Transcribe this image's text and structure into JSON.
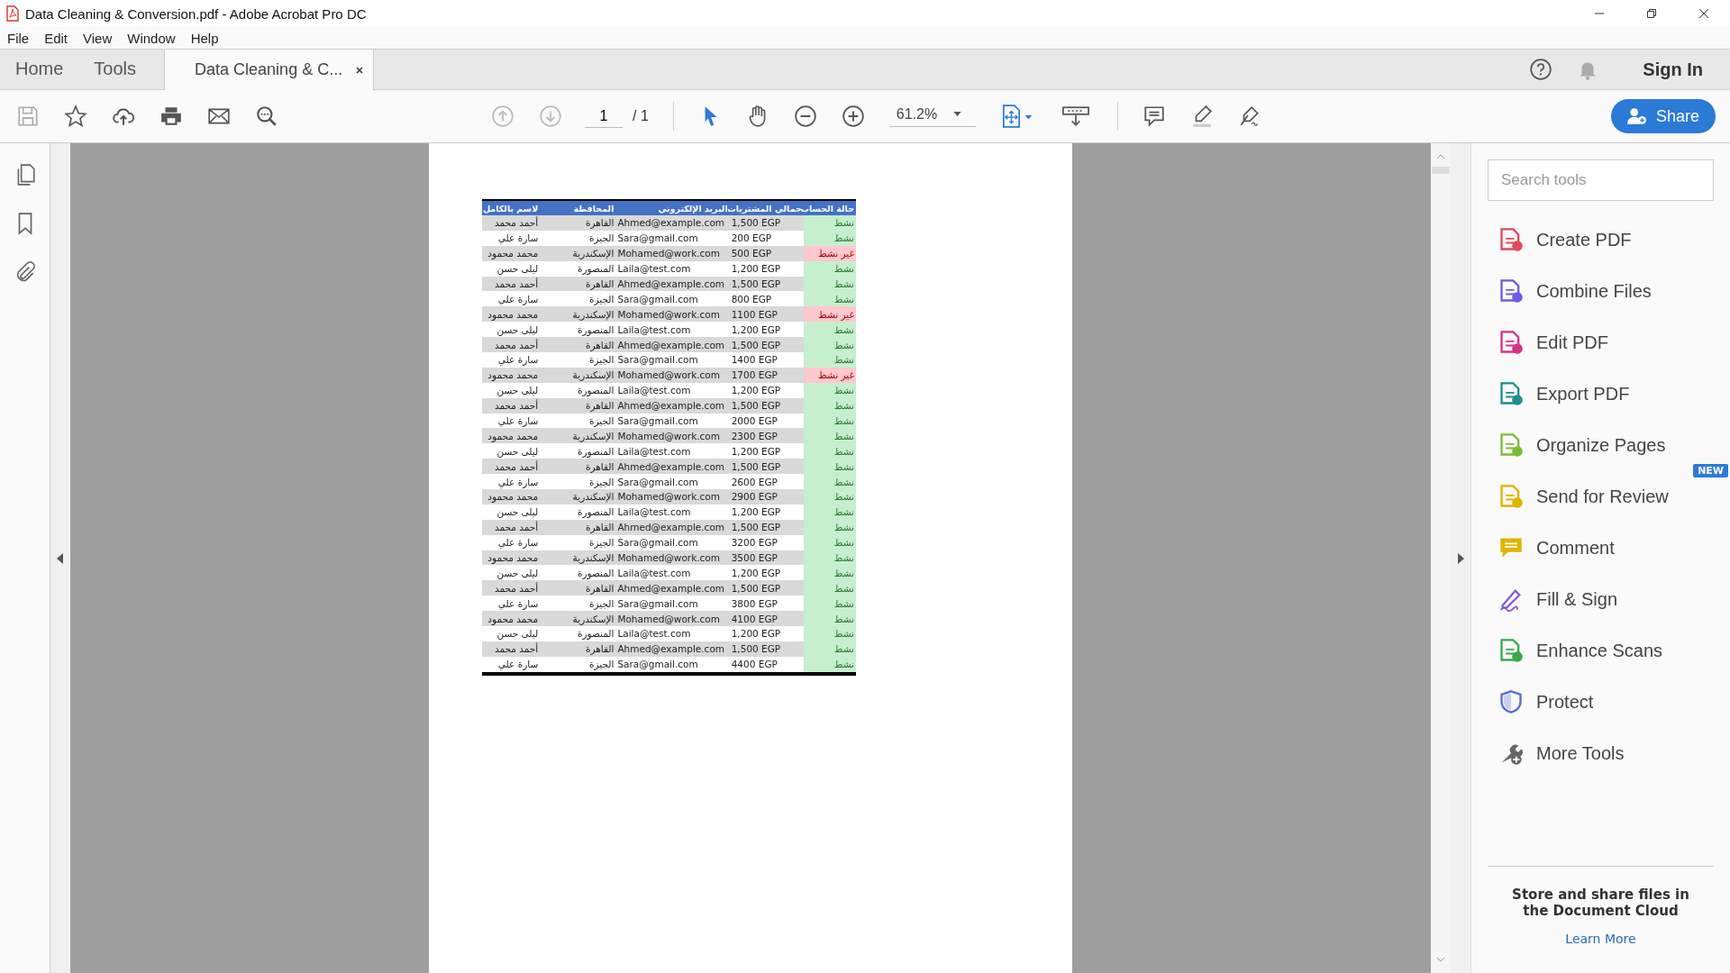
{
  "window": {
    "title": "Data Cleaning & Conversion.pdf - Adobe Acrobat Pro DC"
  },
  "menu": {
    "file": "File",
    "edit": "Edit",
    "view": "View",
    "window": "Window",
    "help": "Help"
  },
  "tabs": {
    "home": {
      "label": "Home",
      "selected": false,
      "kind": "nav"
    },
    "tools": {
      "label": "Tools",
      "selected": false,
      "kind": "nav"
    },
    "document": {
      "label": "Data Cleaning & C...",
      "selected": true,
      "kind": "document"
    }
  },
  "account": {
    "sign_in": "Sign In"
  },
  "toolbar": {
    "page": "1",
    "page_total": "/ 1",
    "zoom": "61.2%",
    "share": "Share"
  },
  "table": {
    "columns": [
      "حالة الحساب",
      "جمالي المشتريات",
      "البريد الإلكتروني",
      "المحافظة",
      "لاسم بالكامل"
    ],
    "rows": [
      {
        "status": "نشط",
        "active": true,
        "total": "1,500 EGP",
        "email": "Ahmed@example.com",
        "governorate": "القاهرة",
        "name": "أحمد محمد"
      },
      {
        "status": "نشط",
        "active": true,
        "total": "200 EGP",
        "email": "Sara@gmail.com",
        "governorate": "الجيزة",
        "name": "سارة علي"
      },
      {
        "status": "غير نشط",
        "active": false,
        "total": "500 EGP",
        "email": "Mohamed@work.com",
        "governorate": "الإسكندرية",
        "name": "محمد محمود"
      },
      {
        "status": "نشط",
        "active": true,
        "total": "1,200 EGP",
        "email": "Laila@test.com",
        "governorate": "المنصورة",
        "name": "ليلى حسن"
      },
      {
        "status": "نشط",
        "active": true,
        "total": "1,500 EGP",
        "email": "Ahmed@example.com",
        "governorate": "القاهرة",
        "name": "أحمد محمد"
      },
      {
        "status": "نشط",
        "active": true,
        "total": "800 EGP",
        "email": "Sara@gmail.com",
        "governorate": "الجيزة",
        "name": "سارة علي"
      },
      {
        "status": "غير نشط",
        "active": false,
        "total": "1100 EGP",
        "email": "Mohamed@work.com",
        "governorate": "الإسكندرية",
        "name": "محمد محمود"
      },
      {
        "status": "نشط",
        "active": true,
        "total": "1,200 EGP",
        "email": "Laila@test.com",
        "governorate": "المنصورة",
        "name": "ليلى حسن"
      },
      {
        "status": "نشط",
        "active": true,
        "total": "1,500 EGP",
        "email": "Ahmed@example.com",
        "governorate": "القاهرة",
        "name": "أحمد محمد"
      },
      {
        "status": "نشط",
        "active": true,
        "total": "1400 EGP",
        "email": "Sara@gmail.com",
        "governorate": "الجيزة",
        "name": "سارة علي"
      },
      {
        "status": "غير نشط",
        "active": false,
        "total": "1700 EGP",
        "email": "Mohamed@work.com",
        "governorate": "الإسكندرية",
        "name": "محمد محمود"
      },
      {
        "status": "نشط",
        "active": true,
        "total": "1,200 EGP",
        "email": "Laila@test.com",
        "governorate": "المنصورة",
        "name": "ليلى حسن"
      },
      {
        "status": "نشط",
        "active": true,
        "total": "1,500 EGP",
        "email": "Ahmed@example.com",
        "governorate": "القاهرة",
        "name": "أحمد محمد"
      },
      {
        "status": "نشط",
        "active": true,
        "total": "2000 EGP",
        "email": "Sara@gmail.com",
        "governorate": "الجيزة",
        "name": "سارة علي"
      },
      {
        "status": "نشط",
        "active": true,
        "total": "2300 EGP",
        "email": "Mohamed@work.com",
        "governorate": "الإسكندرية",
        "name": "محمد محمود"
      },
      {
        "status": "نشط",
        "active": true,
        "total": "1,200 EGP",
        "email": "Laila@test.com",
        "governorate": "المنصورة",
        "name": "ليلى حسن"
      },
      {
        "status": "نشط",
        "active": true,
        "total": "1,500 EGP",
        "email": "Ahmed@example.com",
        "governorate": "القاهرة",
        "name": "أحمد محمد"
      },
      {
        "status": "نشط",
        "active": true,
        "total": "2600 EGP",
        "email": "Sara@gmail.com",
        "governorate": "الجيزة",
        "name": "سارة علي"
      },
      {
        "status": "نشط",
        "active": true,
        "total": "2900 EGP",
        "email": "Mohamed@work.com",
        "governorate": "الإسكندرية",
        "name": "محمد محمود"
      },
      {
        "status": "نشط",
        "active": true,
        "total": "1,200 EGP",
        "email": "Laila@test.com",
        "governorate": "المنصورة",
        "name": "ليلى حسن"
      },
      {
        "status": "نشط",
        "active": true,
        "total": "1,500 EGP",
        "email": "Ahmed@example.com",
        "governorate": "القاهرة",
        "name": "أحمد محمد"
      },
      {
        "status": "نشط",
        "active": true,
        "total": "3200 EGP",
        "email": "Sara@gmail.com",
        "governorate": "الجيزة",
        "name": "سارة علي"
      },
      {
        "status": "نشط",
        "active": true,
        "total": "3500 EGP",
        "email": "Mohamed@work.com",
        "governorate": "الإسكندرية",
        "name": "محمد محمود"
      },
      {
        "status": "نشط",
        "active": true,
        "total": "1,200 EGP",
        "email": "Laila@test.com",
        "governorate": "المنصورة",
        "name": "ليلى حسن"
      },
      {
        "status": "نشط",
        "active": true,
        "total": "1,500 EGP",
        "email": "Ahmed@example.com",
        "governorate": "القاهرة",
        "name": "أحمد محمد"
      },
      {
        "status": "نشط",
        "active": true,
        "total": "3800 EGP",
        "email": "Sara@gmail.com",
        "governorate": "الجيزة",
        "name": "سارة علي"
      },
      {
        "status": "نشط",
        "active": true,
        "total": "4100 EGP",
        "email": "Mohamed@work.com",
        "governorate": "الإسكندرية",
        "name": "محمد محمود"
      },
      {
        "status": "نشط",
        "active": true,
        "total": "1,200 EGP",
        "email": "Laila@test.com",
        "governorate": "المنصورة",
        "name": "ليلى حسن"
      },
      {
        "status": "نشط",
        "active": true,
        "total": "1,500 EGP",
        "email": "Ahmed@example.com",
        "governorate": "القاهرة",
        "name": "أحمد محمد"
      },
      {
        "status": "نشط",
        "active": true,
        "total": "4400 EGP",
        "email": "Sara@gmail.com",
        "governorate": "الجيزة",
        "name": "سارة علي"
      }
    ]
  },
  "search": {
    "placeholder": "Search tools"
  },
  "tools": [
    {
      "label": "Create PDF"
    },
    {
      "label": "Combine Files"
    },
    {
      "label": "Edit PDF"
    },
    {
      "label": "Export PDF"
    },
    {
      "label": "Organize Pages"
    },
    {
      "label": "Send for Review",
      "badge": "NEW"
    },
    {
      "label": "Comment"
    },
    {
      "label": "Fill & Sign"
    },
    {
      "label": "Enhance Scans"
    },
    {
      "label": "Protect"
    },
    {
      "label": "More Tools"
    }
  ],
  "cloud": {
    "message": "Store and share files in the Document Cloud",
    "link": "Learn More"
  }
}
